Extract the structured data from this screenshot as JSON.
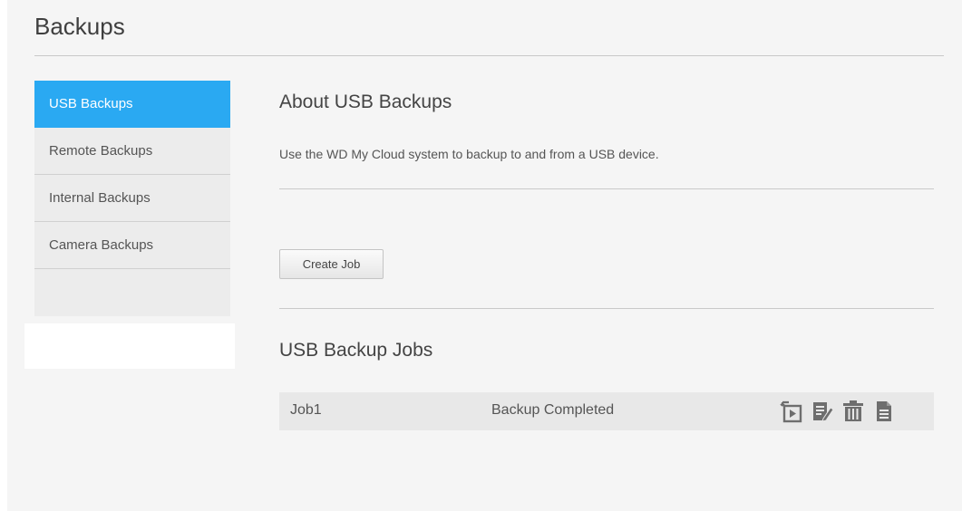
{
  "header": {
    "title": "Backups"
  },
  "sidebar": {
    "items": [
      {
        "label": "USB Backups",
        "active": true
      },
      {
        "label": "Remote Backups",
        "active": false
      },
      {
        "label": "Internal Backups",
        "active": false
      },
      {
        "label": "Camera Backups",
        "active": false
      }
    ]
  },
  "about": {
    "heading": "About USB Backups",
    "description": "Use the WD My Cloud system to backup to and from a USB device."
  },
  "actions": {
    "create_job_label": "Create Job"
  },
  "jobs": {
    "heading": "USB Backup Jobs",
    "rows": [
      {
        "name": "Job1",
        "status": "Backup Completed",
        "icons": [
          "restore-icon",
          "edit-icon",
          "delete-icon",
          "details-icon"
        ]
      }
    ]
  },
  "colors": {
    "accent": "#2aa9f2",
    "icon": "#6e6e6e"
  }
}
